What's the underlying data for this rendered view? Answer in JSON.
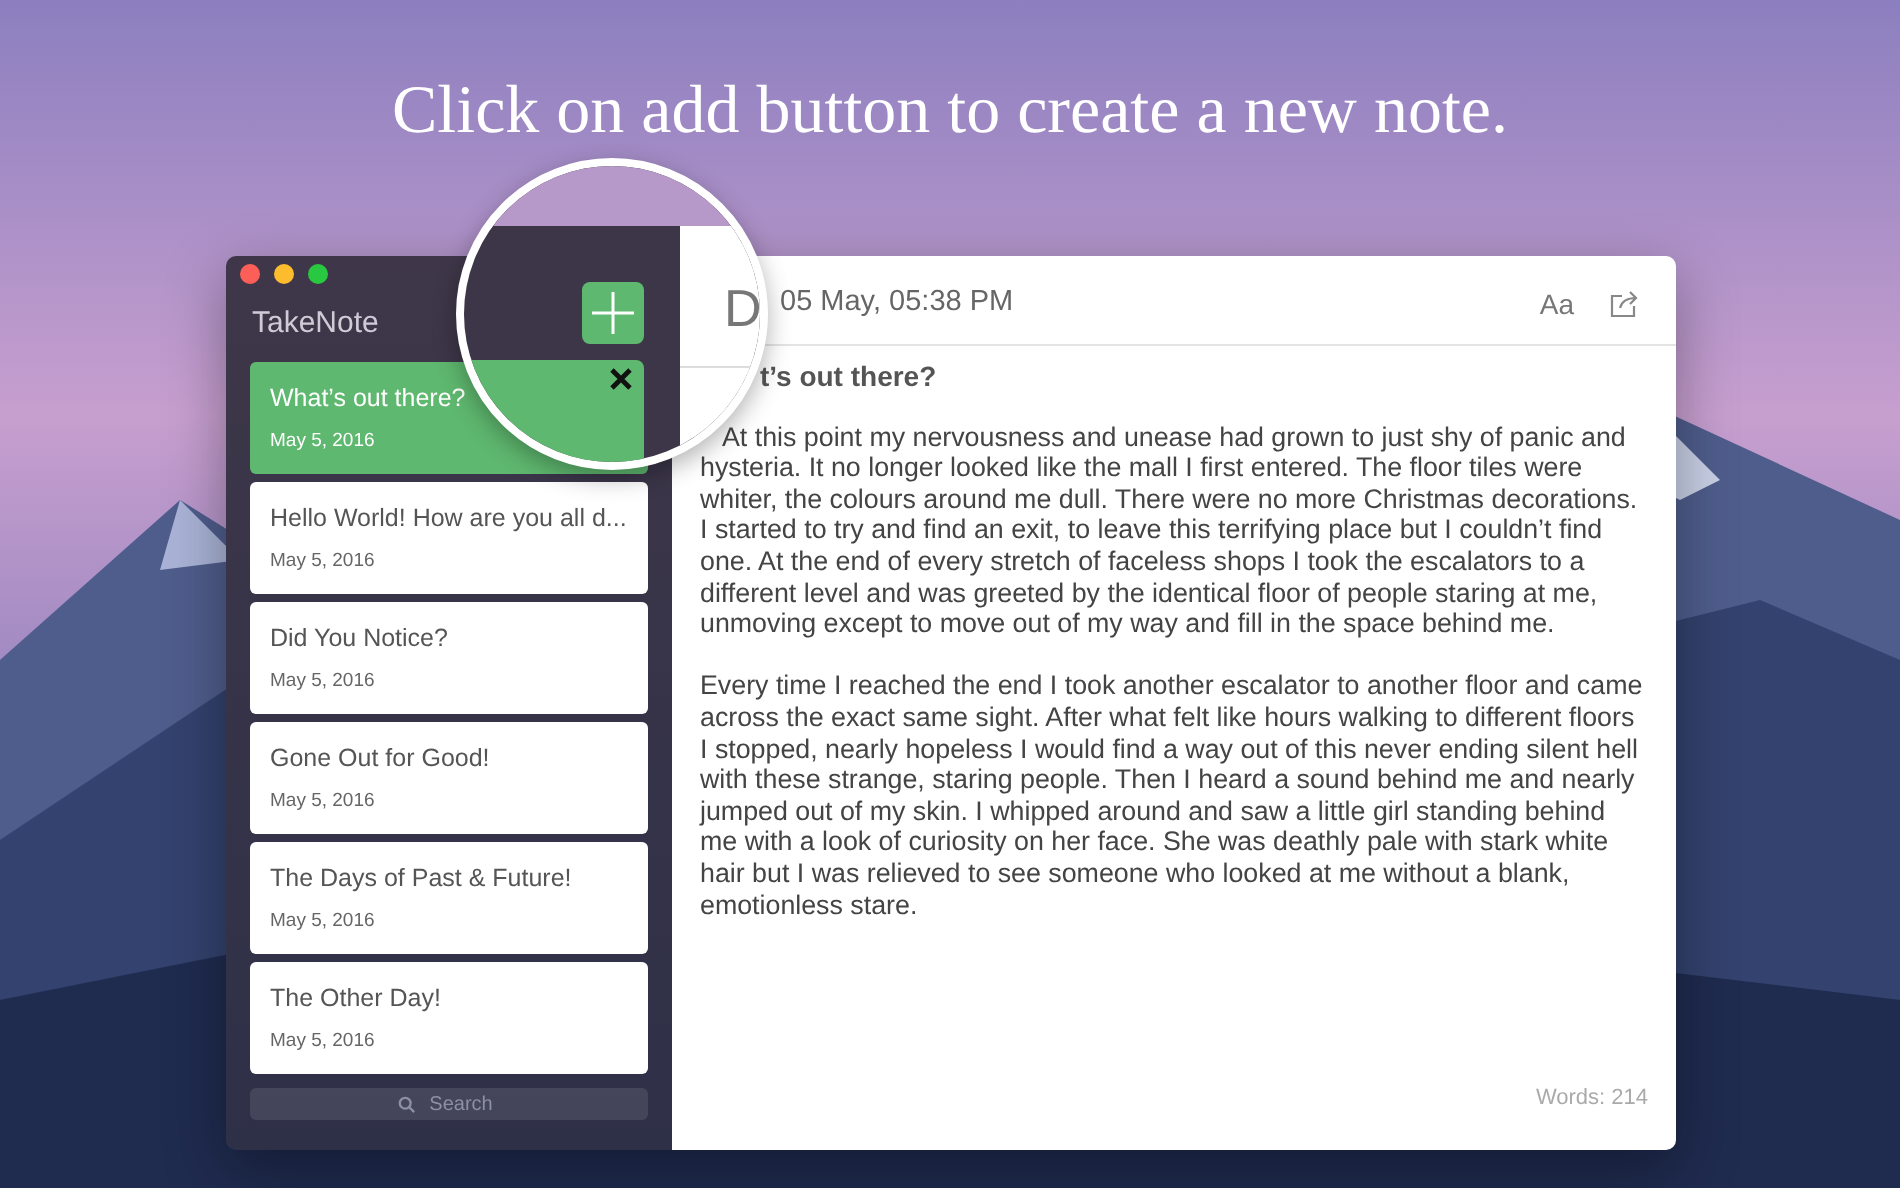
{
  "caption": "Click on add button to create a new note.",
  "window": {
    "title": "TakeNote"
  },
  "notes": [
    {
      "title": "What’s out there?",
      "date": "May 5, 2016",
      "selected": true
    },
    {
      "title": "Hello World! How are you all d...",
      "date": "May 5, 2016",
      "selected": false
    },
    {
      "title": "Did You Notice?",
      "date": "May 5, 2016",
      "selected": false
    },
    {
      "title": "Gone Out for Good!",
      "date": "May 5, 2016",
      "selected": false
    },
    {
      "title": "The Days of Past & Future!",
      "date": "May 5, 2016",
      "selected": false
    },
    {
      "title": "The Other Day!",
      "date": "May 5, 2016",
      "selected": false
    }
  ],
  "search": {
    "placeholder": "Search"
  },
  "editor": {
    "date": "05 May, 05:38 PM",
    "font_button": "Aa",
    "title": "t’s out there?",
    "paragraphs": [
      "At this point my nervousness and unease had grown to just shy of panic and hysteria. It no longer looked like the mall I first entered. The floor tiles were whiter, the colours around me dull. There were no more Christmas decorations. I started to try and find an exit, to leave this terrifying place but I couldn’t find one. At the end of every stretch of faceless shops I took the escalators to a different level and was greeted by the identical floor of people staring at me, unmoving except to move out of my way and fill in the space behind me.",
      "Every time I reached the end I took another escalator to another floor and came across the exact same sight. After what felt like hours walking to different floors I stopped, nearly hopeless I would find a way out of this never ending silent hell with these strange, staring people. Then I heard a sound behind me and nearly jumped out of my skin. I whipped around and saw a little girl standing behind me with a look of curiosity on her face. She was deathly pale with stark white hair but I was relieved to see someone who looked at me without a blank, emotionless stare."
    ],
    "word_count": "Words: 214"
  },
  "magnifier": {
    "header_fragment": "D"
  }
}
